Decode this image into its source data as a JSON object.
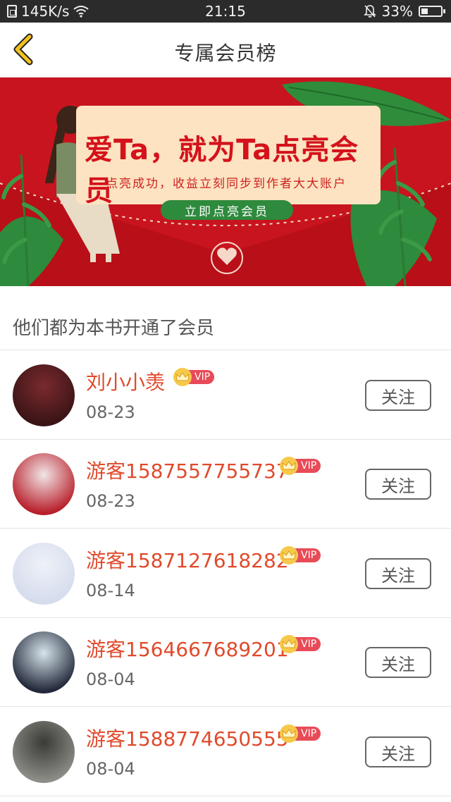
{
  "status_bar": {
    "net_speed": "145K/s",
    "time": "21:15",
    "battery": "33%",
    "battery_level": 0.33,
    "icons": [
      "sim-icon",
      "wifi-icon",
      "bell-muted-icon",
      "battery-icon"
    ]
  },
  "header": {
    "title": "专属会员榜",
    "back_icon": "chevron-left-icon"
  },
  "banner": {
    "title": "爱Ta，就为Ta点亮会员",
    "subtitle": "点亮成功，收益立刻同步到作者大大账户",
    "button": "立即点亮会员",
    "colors": {
      "background": "#c8141e",
      "card": "#fde3c1",
      "button": "#2e8a3d"
    }
  },
  "section": {
    "title": "他们都为本书开通了会员"
  },
  "vip_text": "VIP",
  "members": [
    {
      "name": "刘小小羡",
      "date": "08-23",
      "follow": "关注",
      "avatar_colors": [
        "#3a1416",
        "#7a2a2e"
      ]
    },
    {
      "name": "游客1587557755737",
      "date": "08-23",
      "follow": "关注",
      "avatar_colors": [
        "#b81f2b",
        "#f1e6e6"
      ]
    },
    {
      "name": "游客1587127618282",
      "date": "08-14",
      "follow": "关注",
      "avatar_colors": [
        "#d5dcec",
        "#eef1f8"
      ]
    },
    {
      "name": "游客1564667689201",
      "date": "08-04",
      "follow": "关注",
      "avatar_colors": [
        "#22283a",
        "#d6e4ea"
      ]
    },
    {
      "name": "游客1588774650555",
      "date": "08-04",
      "follow": "关注",
      "avatar_colors": [
        "#8d8d88",
        "#3a3a36"
      ]
    }
  ],
  "colors": {
    "name": "#e04a2c",
    "vip_label": "#e84b58",
    "vip_crown": "#f6c94b",
    "back_arrow": "#f3c21f"
  }
}
